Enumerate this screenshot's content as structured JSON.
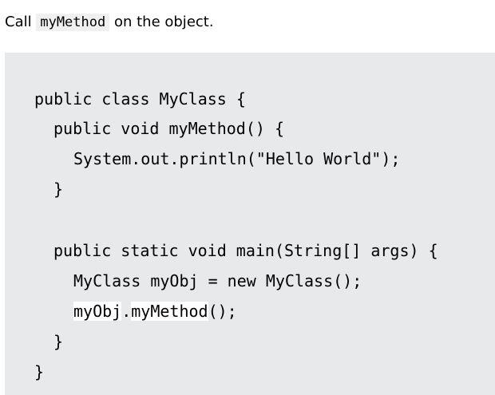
{
  "intro": {
    "prefix": "Call",
    "method": "myMethod",
    "suffix": "on the object."
  },
  "code": {
    "line1": "public class MyClass {",
    "line2": "public void myMethod() {",
    "line3": "System.out.println(\"Hello World\");",
    "line4": "}",
    "line6": "public static void main(String[] args) {",
    "line7": "MyClass myObj = new MyClass();",
    "line8_object": "myObj",
    "line8_dot": ".",
    "line8_method": "myMethod",
    "line8_call": "();",
    "line9": "}",
    "line10": "}"
  }
}
